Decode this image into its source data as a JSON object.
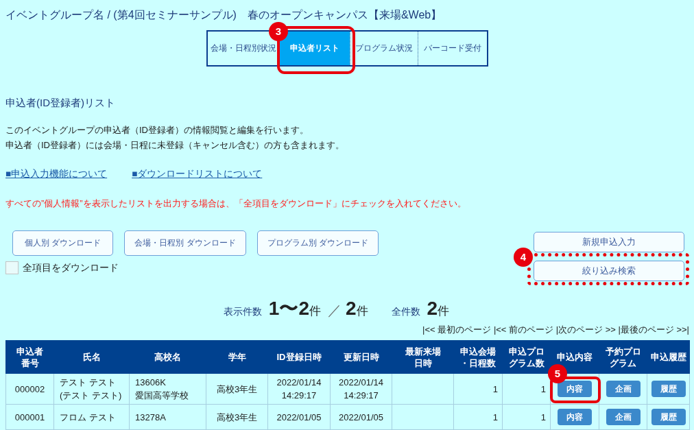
{
  "title": "イベントグループ名 / (第4回セミナーサンプル)　春のオープンキャンパス【来場&Web】",
  "tabs": [
    {
      "label": "会場・日程別状況",
      "selected": false
    },
    {
      "label": "申込者リスト",
      "selected": true,
      "callout": "3"
    },
    {
      "label": "プログラム状況",
      "selected": false
    },
    {
      "label": "バーコード受付",
      "selected": false
    }
  ],
  "section_title": "申込者(ID登録者)リスト",
  "description": [
    "このイベントグループの申込者（ID登録者）の情報閲覧と編集を行います。",
    "申込者（ID登録者）には会場・日程に未登録（キャンセル含む）の方も含まれます。"
  ],
  "links": [
    "■申込入力機能について",
    "■ダウンロードリストについて"
  ],
  "notice": "すべての”個人情報”を表示したリストを出力する場合は、「全項目をダウンロード」にチェックを入れてください。",
  "download_buttons": [
    "個人別 ダウンロード",
    "会場・日程別 ダウンロード",
    "プログラム別 ダウンロード"
  ],
  "download_all": {
    "label": "全項目をダウンロード",
    "checked": false
  },
  "action_buttons": [
    {
      "label": "新規申込入力"
    },
    {
      "label": "絞り込み検索",
      "callout": "4"
    }
  ],
  "summary": [
    {
      "kind": "label",
      "text": "表示件数"
    },
    {
      "kind": "number",
      "text": "1〜2"
    },
    {
      "kind": "unit",
      "text": "件"
    },
    {
      "kind": "separator",
      "text": "／"
    },
    {
      "kind": "number",
      "text": "2"
    },
    {
      "kind": "unit",
      "text": "件"
    },
    {
      "kind": "label",
      "text": "全件数"
    },
    {
      "kind": "number",
      "text": "2"
    },
    {
      "kind": "unit",
      "text": "件"
    }
  ],
  "pagination": "|<< 最初のページ |<< 前のページ |次のページ >> |最後のページ >>|",
  "table": {
    "columns": [
      [
        "申込者",
        "番号"
      ],
      [
        "氏名"
      ],
      [
        "高校名"
      ],
      [
        "学年"
      ],
      [
        "ID登録日時"
      ],
      [
        "更新日時"
      ],
      [
        "最新来場",
        "日時"
      ],
      [
        "申込会場",
        "・日程数"
      ],
      [
        "申込プロ",
        "グラム数"
      ],
      [
        "申込内容"
      ],
      [
        "予約プロ",
        "グラム"
      ],
      [
        "申込履歴"
      ]
    ],
    "rows": [
      {
        "number": "000002",
        "name": [
          "テスト テスト",
          "(テスト テスト)"
        ],
        "school": [
          "13606K",
          "愛国高等学校"
        ],
        "grade": "高校3年生",
        "registered": [
          "2022/01/14",
          "14:29:17"
        ],
        "updated": [
          "2022/01/14",
          "14:29:17"
        ],
        "venue_count": "1",
        "program_count": "1",
        "actions": [
          {
            "label": "内容",
            "callout": "5"
          },
          {
            "label": "企画"
          },
          {
            "label": "履歴"
          }
        ]
      },
      {
        "number": "000001",
        "name": [
          "フロム テスト"
        ],
        "school": [
          "13278A"
        ],
        "grade": "高校3年生",
        "registered": [
          "2022/01/05"
        ],
        "updated": [
          "2022/01/05"
        ],
        "venue_count": "1",
        "program_count": "1",
        "actions": [
          {
            "label": "内容"
          },
          {
            "label": "企画"
          },
          {
            "label": "履歴"
          }
        ]
      }
    ]
  }
}
